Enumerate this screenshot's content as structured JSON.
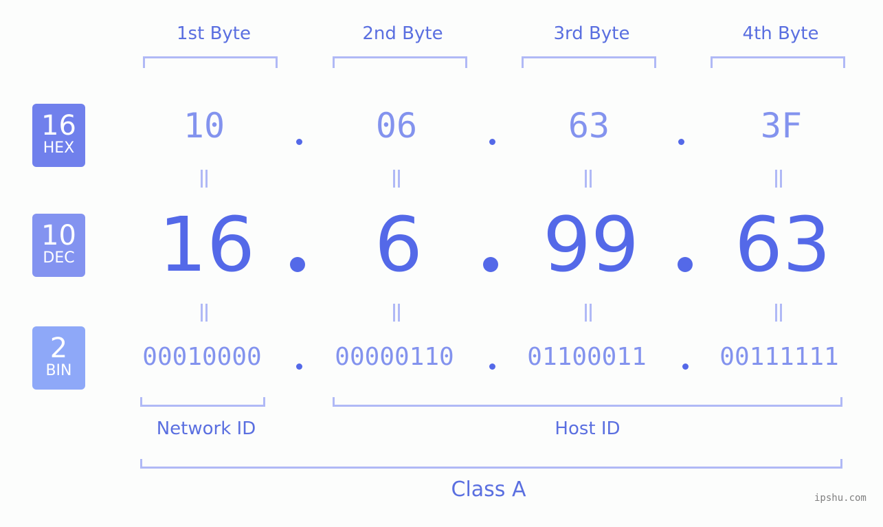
{
  "headers": [
    "1st Byte",
    "2nd Byte",
    "3rd Byte",
    "4th Byte"
  ],
  "badges": {
    "hex": {
      "num": "16",
      "label": "HEX",
      "color": "#7080ec"
    },
    "dec": {
      "num": "10",
      "label": "DEC",
      "color": "#8393f0"
    },
    "bin": {
      "num": "2",
      "label": "BIN",
      "color": "#8ea8f8"
    }
  },
  "hex": [
    "10",
    "06",
    "63",
    "3F"
  ],
  "dec": [
    "16",
    "6",
    "99",
    "63"
  ],
  "bin": [
    "00010000",
    "00000110",
    "01100011",
    "00111111"
  ],
  "equals": "=",
  "network_id": "Network ID",
  "host_id": "Host ID",
  "class_label": "Class A",
  "watermark": "ipshu.com",
  "colors": {
    "accent": "#5469e8",
    "light": "#b0b9f6"
  }
}
